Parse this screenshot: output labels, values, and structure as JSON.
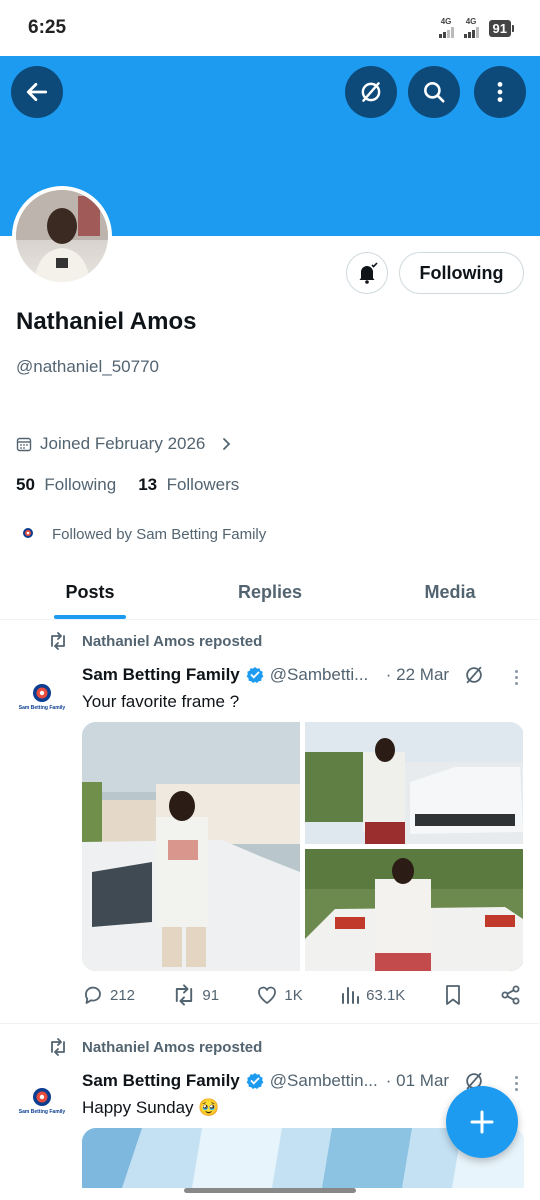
{
  "status_bar": {
    "time": "6:25",
    "signal_1": "4G",
    "signal_2": "4G",
    "battery": "91"
  },
  "profile": {
    "name": "Nathaniel Amos",
    "handle": "@nathaniel_50770",
    "joined": "Joined February 2026",
    "following_count": "50",
    "following_label": "Following",
    "followers_count": "13",
    "followers_label": "Followers",
    "followed_by": "Followed by Sam Betting Family",
    "follow_button": "Following"
  },
  "tabs": [
    {
      "label": "Posts",
      "active": true
    },
    {
      "label": "Replies",
      "active": false
    },
    {
      "label": "Media",
      "active": false
    }
  ],
  "posts": [
    {
      "repost_label": "Nathaniel Amos reposted",
      "author": "Sam Betting Family",
      "avatar_text": "Sam Betting Family",
      "handle": "@Sambetti...",
      "date": "· 22 Mar",
      "text": "Your favorite frame ?",
      "replies": "212",
      "reposts": "91",
      "likes": "1K",
      "views": "63.1K"
    },
    {
      "repost_label": "Nathaniel Amos reposted",
      "author": "Sam Betting Family",
      "avatar_text": "Sam Betting Family",
      "handle": "@Sambettin...",
      "date": "· 01 Mar",
      "text": "Happy Sunday 🥹"
    }
  ],
  "colors": {
    "accent": "#1d9bf0",
    "banner": "#1d9bf0",
    "button_dark": "#0d4a7a",
    "text_secondary": "#536471"
  },
  "icons": [
    "back-arrow-icon",
    "grok-icon",
    "search-icon",
    "more-vertical-icon",
    "bell-icon",
    "calendar-icon",
    "chevron-right-icon",
    "repost-icon",
    "verified-badge-icon",
    "reply-icon",
    "like-icon",
    "views-icon",
    "bookmark-icon",
    "share-icon",
    "plus-icon"
  ]
}
